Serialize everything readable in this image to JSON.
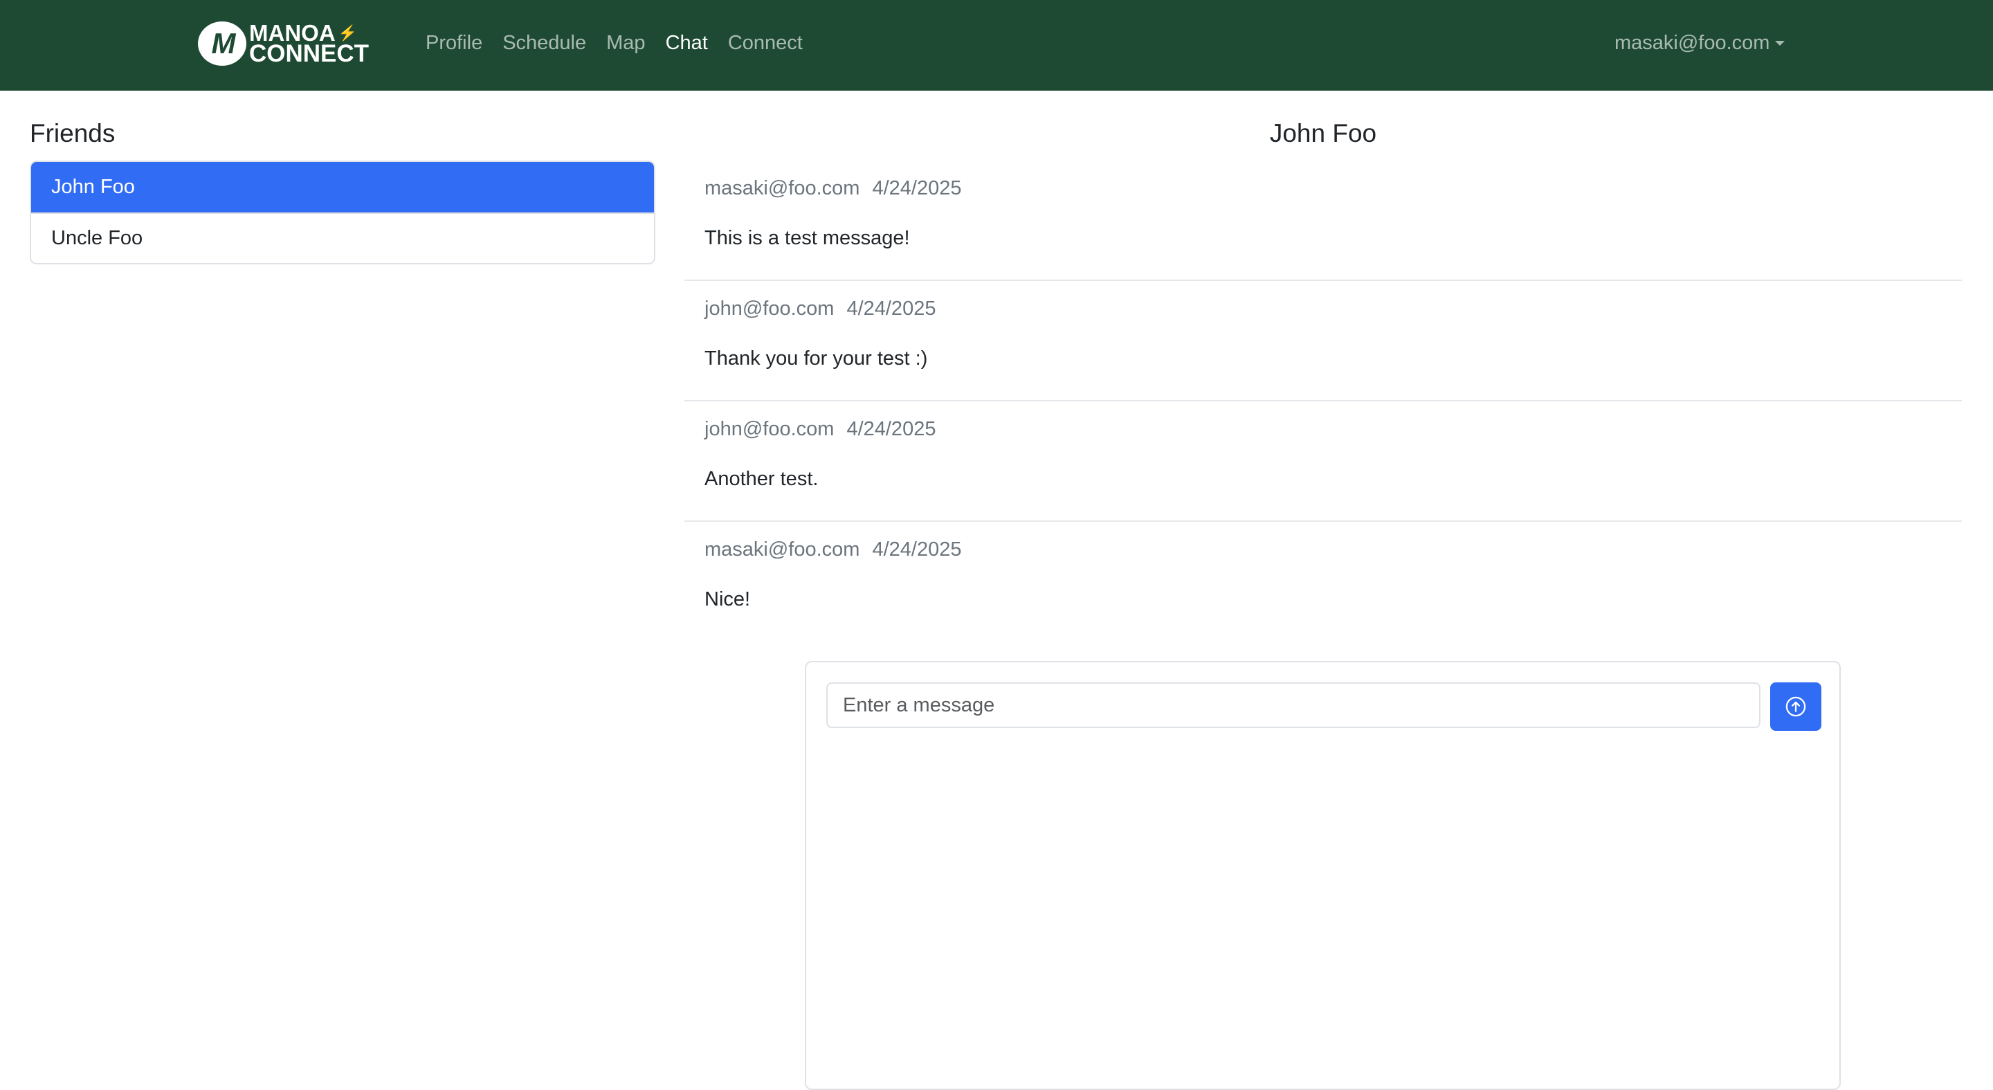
{
  "nav": {
    "brand_top": "MANOA",
    "brand_bottom": "CONNECT",
    "brand_mark": "M",
    "links": [
      {
        "label": "Profile",
        "active": false
      },
      {
        "label": "Schedule",
        "active": false
      },
      {
        "label": "Map",
        "active": false
      },
      {
        "label": "Chat",
        "active": true
      },
      {
        "label": "Connect",
        "active": false
      }
    ],
    "user": "masaki@foo.com"
  },
  "friends": {
    "title": "Friends",
    "items": [
      {
        "name": "John Foo",
        "active": true
      },
      {
        "name": "Uncle Foo",
        "active": false
      }
    ]
  },
  "chat": {
    "title": "John Foo",
    "messages": [
      {
        "sender": "masaki@foo.com",
        "date": "4/24/2025",
        "text": "This is a test message!"
      },
      {
        "sender": "john@foo.com",
        "date": "4/24/2025",
        "text": "Thank you for your test :)"
      },
      {
        "sender": "john@foo.com",
        "date": "4/24/2025",
        "text": "Another test."
      },
      {
        "sender": "masaki@foo.com",
        "date": "4/24/2025",
        "text": "Nice!"
      }
    ],
    "input_placeholder": "Enter a message",
    "send_icon": "arrow-up-circle-icon"
  },
  "colors": {
    "navbar": "#1e4a34",
    "accent": "#316cf4"
  }
}
